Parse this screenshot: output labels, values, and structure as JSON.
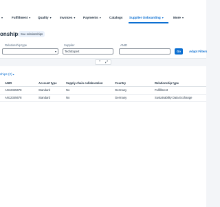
{
  "nav": {
    "items": [
      {
        "label": "",
        "active": false
      },
      {
        "label": "Fulfillment",
        "active": false
      },
      {
        "label": "Quality",
        "active": false
      },
      {
        "label": "Invoices",
        "active": false
      },
      {
        "label": "Payments",
        "active": false
      },
      {
        "label": "Catalogs",
        "active": false
      },
      {
        "label": "Supplier Onboarding",
        "active": true
      },
      {
        "label": "More",
        "active": false
      }
    ],
    "chevron": "▾"
  },
  "header": {
    "title": "onships",
    "view_link": "See relationships"
  },
  "filters": {
    "relationship_type": {
      "label": "Relationship type",
      "value": ""
    },
    "supplier": {
      "label": "Supplier",
      "value": "TechExpert"
    },
    "anid": {
      "label": "ANID",
      "value": ""
    },
    "go_label": "Go",
    "adapt_label": "Adapt Filters"
  },
  "table": {
    "title": "ships (2)",
    "columns": [
      "ANID",
      "Account type",
      "Supply chain collaboration",
      "Country",
      "Relationship type"
    ],
    "rows": [
      [
        "AN12345678",
        "Standard",
        "No",
        "Germany",
        "Fulfillment"
      ],
      [
        "AN12345678",
        "Standard",
        "No",
        "Germany",
        "Sustainability Data Exchange"
      ]
    ]
  },
  "colors": {
    "accent": "#0a6ed1",
    "text": "#1d2d3e",
    "background": "#f3f5f8"
  }
}
